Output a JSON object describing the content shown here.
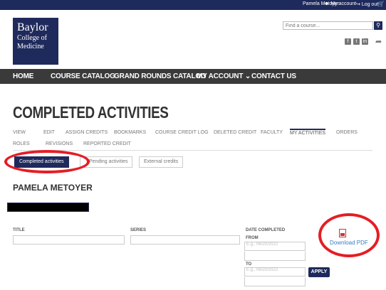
{
  "topbar": {
    "user_name": "Pamela Metoyer",
    "my_account": "My account",
    "log_out": "Log out",
    "cart_icon": "cart-icon"
  },
  "logo": {
    "line1": "Baylor",
    "line2": "College of",
    "line3": "Medicine"
  },
  "search": {
    "placeholder": "Find a course..."
  },
  "nav": {
    "items": [
      "HOME",
      "COURSE CATALOG",
      "GRAND ROUNDS CATALOG",
      "MY ACCOUNT",
      "CONTACT US"
    ],
    "dropdown_marker": "⌄"
  },
  "page_title": "COMPLETED ACTIVITIES",
  "tabs": {
    "row1": [
      "VIEW",
      "EDIT",
      "ASSIGN CREDITS",
      "BOOKMARKS",
      "COURSE CREDIT LOG",
      "DELETED CREDIT",
      "FACULTY",
      "MY ACTIVITIES",
      "ORDERS"
    ],
    "row2": [
      "ROLES",
      "REVISIONS",
      "REPORTED CREDIT"
    ],
    "active": "MY ACTIVITIES"
  },
  "subtabs": [
    "Completed activities",
    "Pending activities",
    "External credits"
  ],
  "subtab_active": "Completed activities",
  "person_name": "PAMELA METOYER",
  "filters": {
    "title_label": "TITLE",
    "series_label": "SERIES",
    "date_completed_label": "DATE COMPLETED",
    "from_label": "FROM",
    "from_placeholder": "E.g., 06/20/2022",
    "to_label": "TO",
    "to_placeholder": "E.g., 06/20/2022",
    "apply_label": "APPLY"
  },
  "download": {
    "label": "Download PDF"
  },
  "colors": {
    "navy": "#1f2a5c",
    "nav_bg": "#3a3a3a",
    "annotation_red": "#e51d25",
    "link_blue": "#3b7dc4"
  }
}
